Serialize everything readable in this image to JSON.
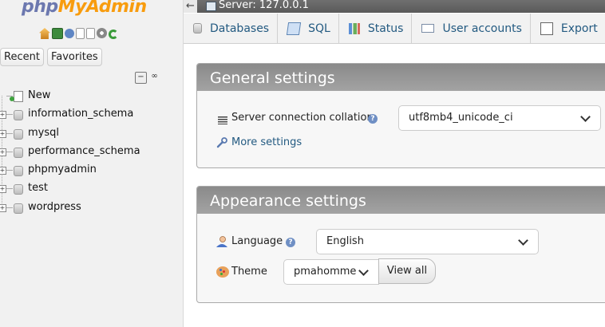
{
  "app": {
    "logo_php": "php",
    "logo_myadmin": "MyAdmin"
  },
  "navigation": {
    "tabs": [
      {
        "label": "Recent"
      },
      {
        "label": "Favorites"
      }
    ],
    "tree": [
      {
        "label": "New",
        "icon": "new-icon"
      },
      {
        "label": "information_schema",
        "icon": "database-icon"
      },
      {
        "label": "mysql",
        "icon": "database-icon"
      },
      {
        "label": "performance_schema",
        "icon": "database-icon"
      },
      {
        "label": "phpmyadmin",
        "icon": "database-icon"
      },
      {
        "label": "test",
        "icon": "database-icon"
      },
      {
        "label": "wordpress",
        "icon": "database-icon"
      }
    ]
  },
  "serverbar": {
    "label": "Server: 127.0.0.1"
  },
  "menu": [
    {
      "label": "Databases",
      "icon": "database-icon"
    },
    {
      "label": "SQL",
      "icon": "sql-icon"
    },
    {
      "label": "Status",
      "icon": "status-icon"
    },
    {
      "label": "User accounts",
      "icon": "user-accounts-icon"
    },
    {
      "label": "Export",
      "icon": "export-icon"
    }
  ],
  "general": {
    "title": "General settings",
    "collation_label": "Server connection collation:",
    "collation_value": "utf8mb4_unicode_ci",
    "more_settings": "More settings"
  },
  "appearance": {
    "title": "Appearance settings",
    "language_label": "Language",
    "language_value": "English",
    "theme_label": "Theme",
    "theme_value": "pmahomme",
    "view_all": "View all"
  },
  "colors": {
    "link": "#235a81",
    "panel_header": "#969696",
    "accent_orange": "#f89c0e",
    "accent_blue": "#6c78af"
  }
}
